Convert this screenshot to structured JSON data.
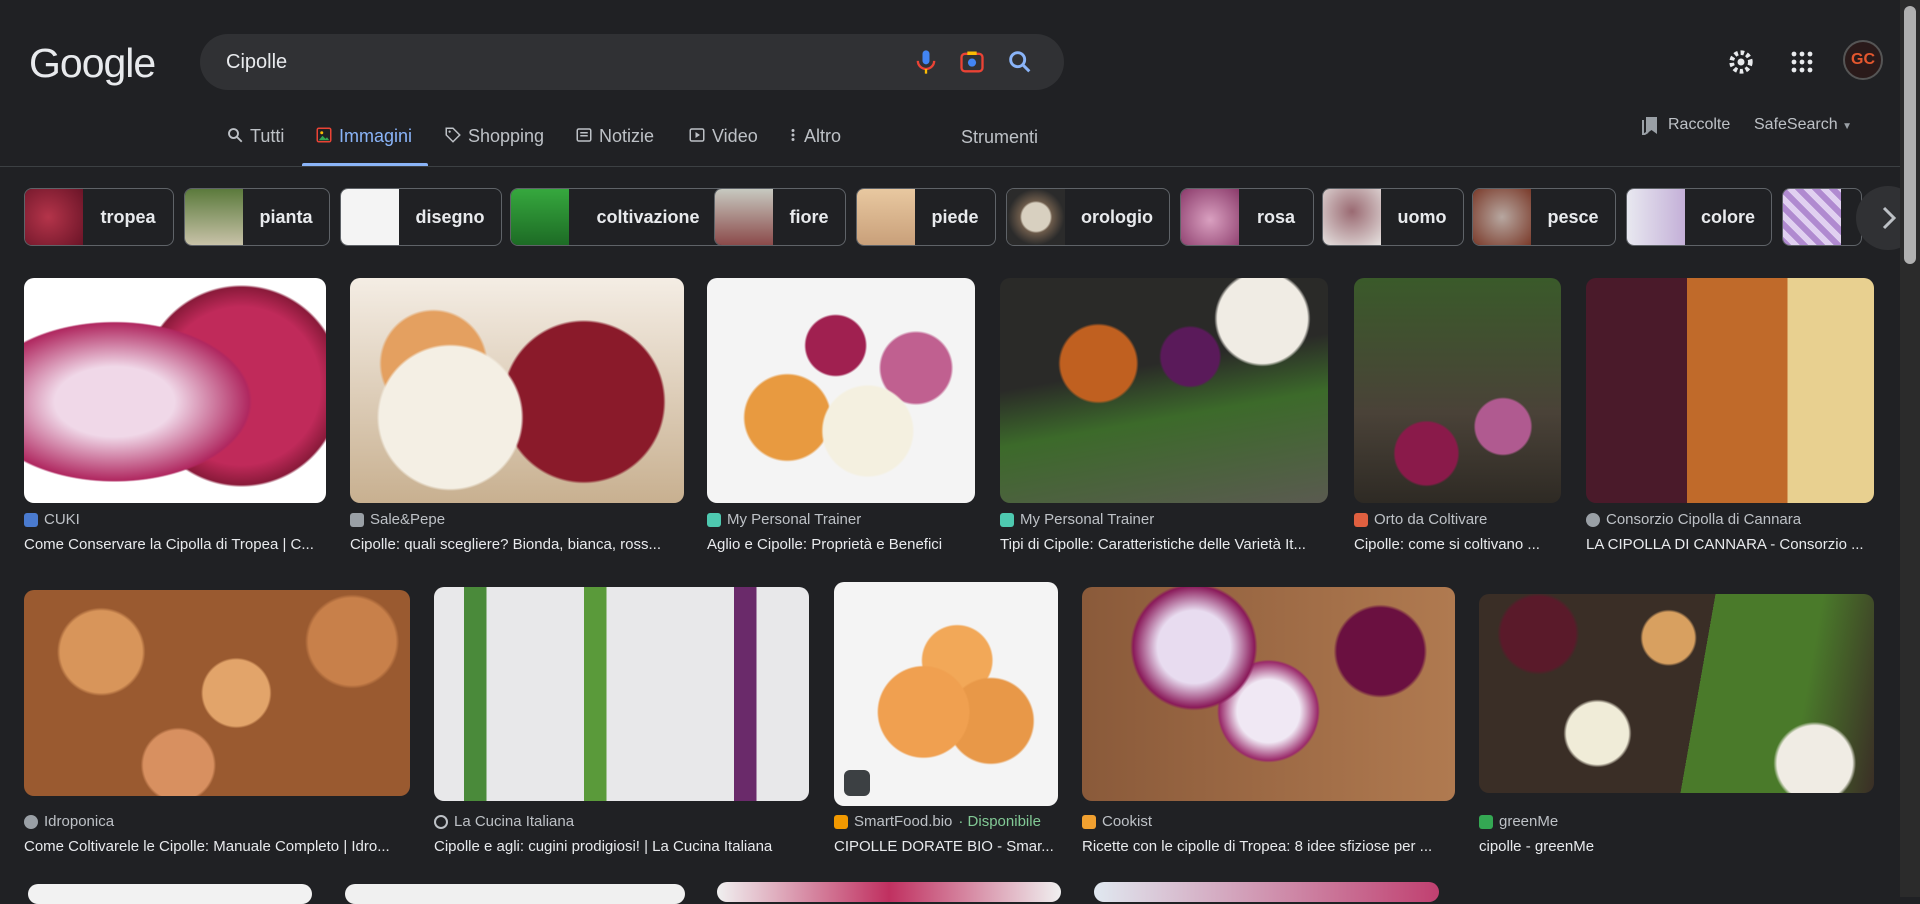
{
  "logo": "Google",
  "search": {
    "query": "Cipolle"
  },
  "tabs": [
    {
      "label": "Tutti",
      "icon": "search-icon"
    },
    {
      "label": "Immagini",
      "icon": "image-icon"
    },
    {
      "label": "Shopping",
      "icon": "tag-icon"
    },
    {
      "label": "Notizie",
      "icon": "news-icon"
    },
    {
      "label": "Video",
      "icon": "play-icon"
    },
    {
      "label": "Altro",
      "icon": "more-vert-icon"
    }
  ],
  "tools_label": "Strumenti",
  "raccolte_label": "Raccolte",
  "safesearch_label": "SafeSearch",
  "avatar_initials": "GC",
  "chips": [
    {
      "label": "tropea"
    },
    {
      "label": "pianta"
    },
    {
      "label": "disegno"
    },
    {
      "label": "coltivazione"
    },
    {
      "label": "fiore"
    },
    {
      "label": "piede"
    },
    {
      "label": "orologio"
    },
    {
      "label": "rosa"
    },
    {
      "label": "uomo"
    },
    {
      "label": "pesce"
    },
    {
      "label": "colore"
    }
  ],
  "results": [
    {
      "source": "CUKI",
      "title": "Come Conservare la Cipolla di Tropea | C..."
    },
    {
      "source": "Sale&Pepe",
      "title": "Cipolle: quali scegliere? Bionda, bianca, ross..."
    },
    {
      "source": "My Personal Trainer",
      "title": "Aglio e Cipolle: Proprietà e Benefici"
    },
    {
      "source": "My Personal Trainer",
      "title": "Tipi di Cipolle: Caratteristiche delle Varietà It..."
    },
    {
      "source": "Orto da Coltivare",
      "title": "Cipolle: come si coltivano ..."
    },
    {
      "source": "Consorzio Cipolla di Cannara",
      "title": "LA CIPOLLA DI CANNARA - Consorzio ..."
    },
    {
      "source": "Idroponica",
      "title": "Come Coltivarele le Cipolle: Manuale Completo | Idro..."
    },
    {
      "source": "La Cucina Italiana",
      "title": "Cipolle e agli: cugini prodigiosi! | La Cucina Italiana"
    },
    {
      "source": "SmartFood.bio",
      "availability": "· Disponibile",
      "title": "CIPOLLE DORATE BIO - Smar..."
    },
    {
      "source": "Cookist",
      "title": "Ricette con le cipolle di Tropea: 8 idee sfiziose per ..."
    },
    {
      "source": "greenMe",
      "title": "cipolle - greenMe"
    }
  ],
  "colors": {
    "background": "#202124",
    "accent": "#8ab4f8",
    "available": "#81c995"
  }
}
